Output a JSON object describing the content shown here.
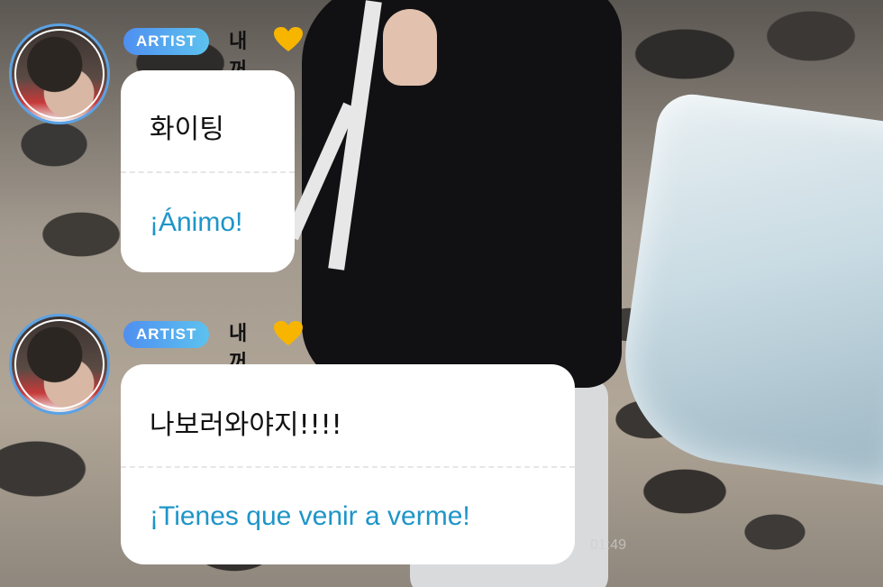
{
  "messages": [
    {
      "badge": "ARTIST",
      "sender": "내꺼",
      "original": "화이팅",
      "translation": "¡Ánimo!"
    },
    {
      "badge": "ARTIST",
      "sender": "내꺼",
      "original": "나보러와야지!!!!",
      "translation": "¡Tienes que venir a verme!"
    }
  ],
  "timestamp": "01:49",
  "colors": {
    "badge_gradient_start": "#4f8ff0",
    "badge_gradient_end": "#5cc2ef",
    "translation_text": "#1e95c8",
    "avatar_ring": "#5ba2e4",
    "heart": "#f7b500"
  },
  "icons": {
    "heart": "yellow-heart-icon"
  }
}
